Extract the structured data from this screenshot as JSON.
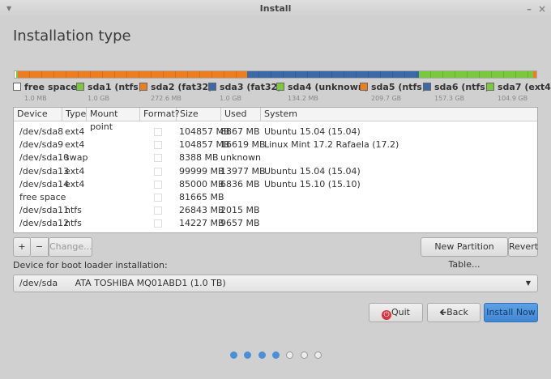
{
  "window": {
    "title": "Install",
    "menu_icon": "triangle-down",
    "minimize": "–",
    "close": "×"
  },
  "page_title": "Installation type",
  "colors": {
    "orange": "#f07d1c",
    "blue": "#3b6aa8",
    "green": "#79c93a",
    "free": "#ffffff",
    "accent": "#4a90d9"
  },
  "partition_bar": [
    {
      "color": "#ffffff",
      "share": 0.3
    },
    {
      "color": "#79c93a",
      "share": 0.4
    },
    {
      "color": "#f07d1c",
      "share": 44
    },
    {
      "color": "#3b6aa8",
      "share": 33
    },
    {
      "color": "#79c93a",
      "share": 22
    },
    {
      "color": "#f07d1c",
      "share": 0.6
    }
  ],
  "legend": [
    {
      "name": "free space",
      "size": "1.0 MB",
      "color": "#ffffff"
    },
    {
      "name": "sda1 (ntfs)",
      "size": "1.0 GB",
      "color": "#79c93a"
    },
    {
      "name": "sda2 (fat32)",
      "size": "272.6 MB",
      "color": "#f07d1c"
    },
    {
      "name": "sda3 (fat32)",
      "size": "1.0 GB",
      "color": "#3b6aa8"
    },
    {
      "name": "sda4 (unknown)",
      "size": "134.2 MB",
      "color": "#79c93a"
    },
    {
      "name": "sda5 (ntfs)",
      "size": "209.7 GB",
      "color": "#f07d1c"
    },
    {
      "name": "sda6 (ntfs)",
      "size": "157.3 GB",
      "color": "#3b6aa8"
    },
    {
      "name": "sda7 (ext4",
      "size": "104.9 GB",
      "color": "#79c93a"
    }
  ],
  "table": {
    "headers": [
      "Device",
      "Type",
      "Mount point",
      "Format?",
      "Size",
      "Used",
      "System"
    ],
    "rows": [
      {
        "device": "/dev/sda8",
        "type": "ext4",
        "mount": "",
        "size": "104857 MB",
        "used": "8867 MB",
        "system": "Ubuntu 15.04 (15.04)"
      },
      {
        "device": "/dev/sda9",
        "type": "ext4",
        "mount": "",
        "size": "104857 MB",
        "used": "16619 MB",
        "system": "Linux Mint 17.2 Rafaela (17.2)"
      },
      {
        "device": "/dev/sda10",
        "type": "swap",
        "mount": "",
        "size": "8388 MB",
        "used": "unknown",
        "system": ""
      },
      {
        "device": "/dev/sda13",
        "type": "ext4",
        "mount": "",
        "size": "99999 MB",
        "used": "13977 MB",
        "system": "Ubuntu 15.04 (15.04)"
      },
      {
        "device": "/dev/sda14",
        "type": "ext4",
        "mount": "",
        "size": "85000 MB",
        "used": "6836 MB",
        "system": "Ubuntu 15.10 (15.10)"
      },
      {
        "device": "free space",
        "type": "",
        "mount": "",
        "size": "81665 MB",
        "used": "",
        "system": ""
      },
      {
        "device": "/dev/sda11",
        "type": "ntfs",
        "mount": "",
        "size": "26843 MB",
        "used": "2015 MB",
        "system": ""
      },
      {
        "device": "/dev/sda12",
        "type": "ntfs",
        "mount": "",
        "size": "14227 MB",
        "used": "9657 MB",
        "system": ""
      }
    ]
  },
  "toolbar": {
    "add": "+",
    "remove": "−",
    "change": "Change...",
    "new_table": "New Partition Table...",
    "revert": "Revert"
  },
  "bootloader": {
    "label": "Device for boot loader installation:",
    "device": "/dev/sda",
    "description": "ATA TOSHIBA MQ01ABD1 (1.0 TB)"
  },
  "buttons": {
    "quit": "Quit",
    "back": "Back",
    "install": "Install Now"
  },
  "progress": {
    "current_step": 4,
    "total_steps": 7
  }
}
